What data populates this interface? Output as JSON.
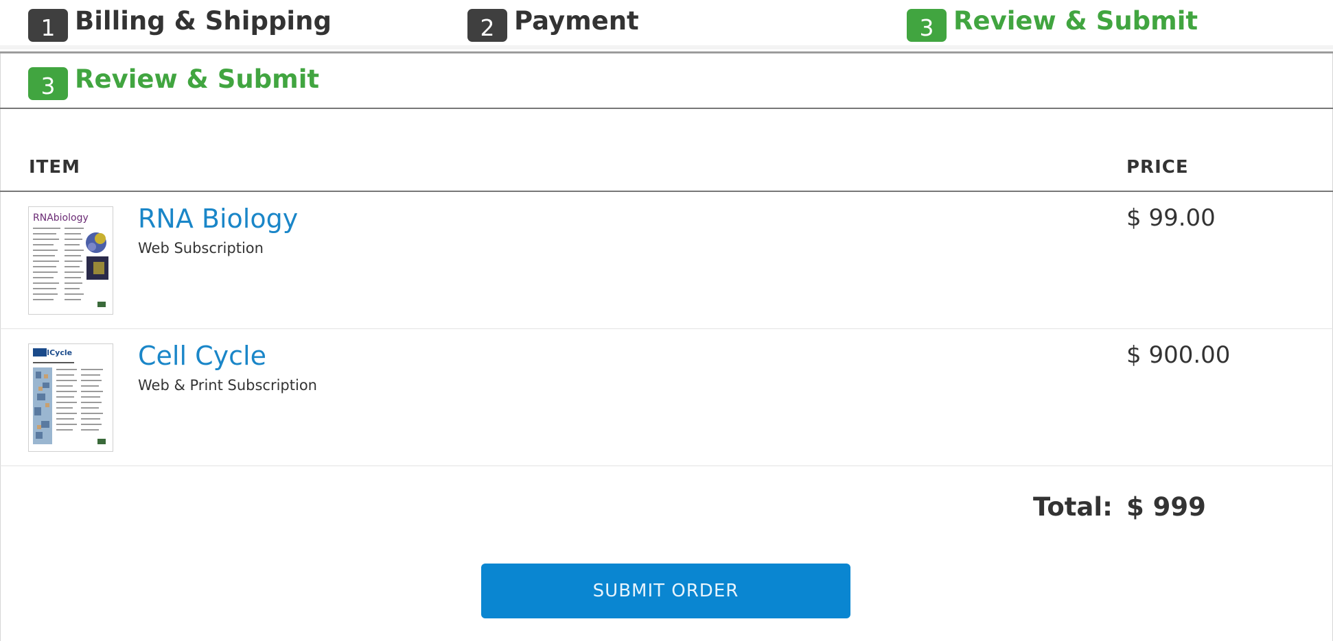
{
  "steps": [
    {
      "number": "1",
      "label": "Billing & Shipping"
    },
    {
      "number": "2",
      "label": "Payment"
    },
    {
      "number": "3",
      "label": "Review & Submit"
    }
  ],
  "active_step": {
    "number": "3",
    "label": "Review & Submit"
  },
  "table": {
    "headers": {
      "item": "ITEM",
      "price": "PRICE"
    },
    "rows": [
      {
        "title": "RNA Biology",
        "subscription": "Web Subscription",
        "price": "$ 99.00",
        "thumbnail": "rna-biology-cover",
        "cover_text": "RNAbiology"
      },
      {
        "title": "Cell Cycle",
        "subscription": "Web & Print Subscription",
        "price": "$ 900.00",
        "thumbnail": "cell-cycle-cover",
        "cover_text": "CellCycle"
      }
    ]
  },
  "total": {
    "label": "Total:",
    "value": "$ 999"
  },
  "submit": {
    "label": "SUBMIT ORDER"
  },
  "colors": {
    "active_green": "#41a540",
    "inactive_badge": "#3f3f3f",
    "link_blue": "#1a86c8",
    "button_blue": "#0a86d1"
  }
}
